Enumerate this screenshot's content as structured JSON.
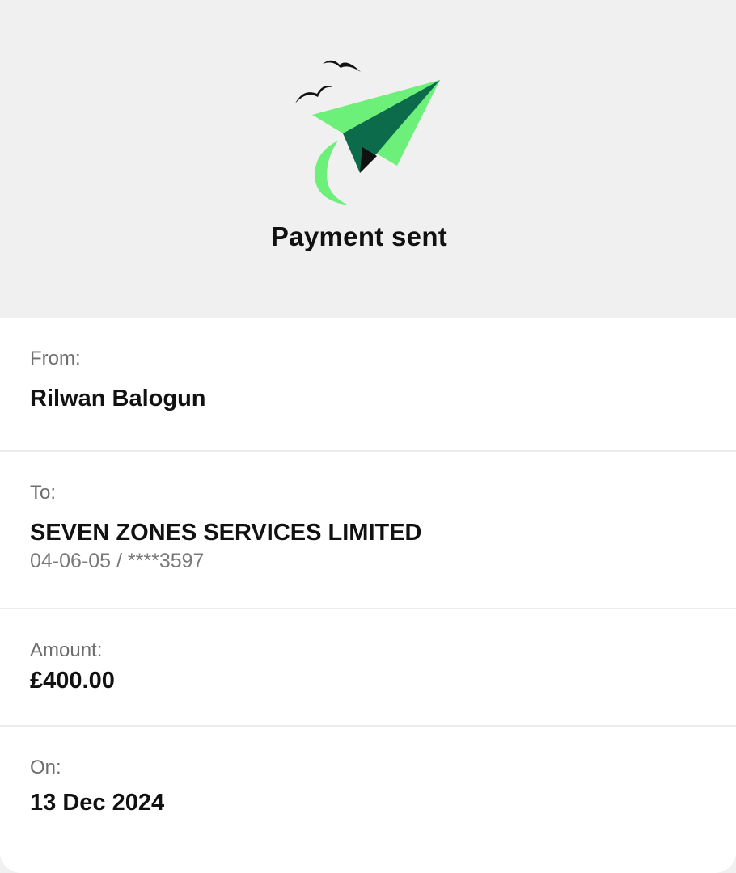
{
  "header": {
    "title": "Payment sent",
    "icon": "paper-plane-icon",
    "colors": {
      "background": "#f0f0f0",
      "plane_light": "#6df07a",
      "plane_dark": "#0b6b4a",
      "plane_shadow": "#111111"
    }
  },
  "details": {
    "from": {
      "label": "From:",
      "value": "Rilwan Balogun"
    },
    "to": {
      "label": "To:",
      "value": "SEVEN ZONES SERVICES LIMITED",
      "account": "04-06-05 / ****3597"
    },
    "amount": {
      "label": "Amount:",
      "value": "£400.00"
    },
    "date": {
      "label": "On:",
      "value": "13 Dec 2024"
    }
  }
}
